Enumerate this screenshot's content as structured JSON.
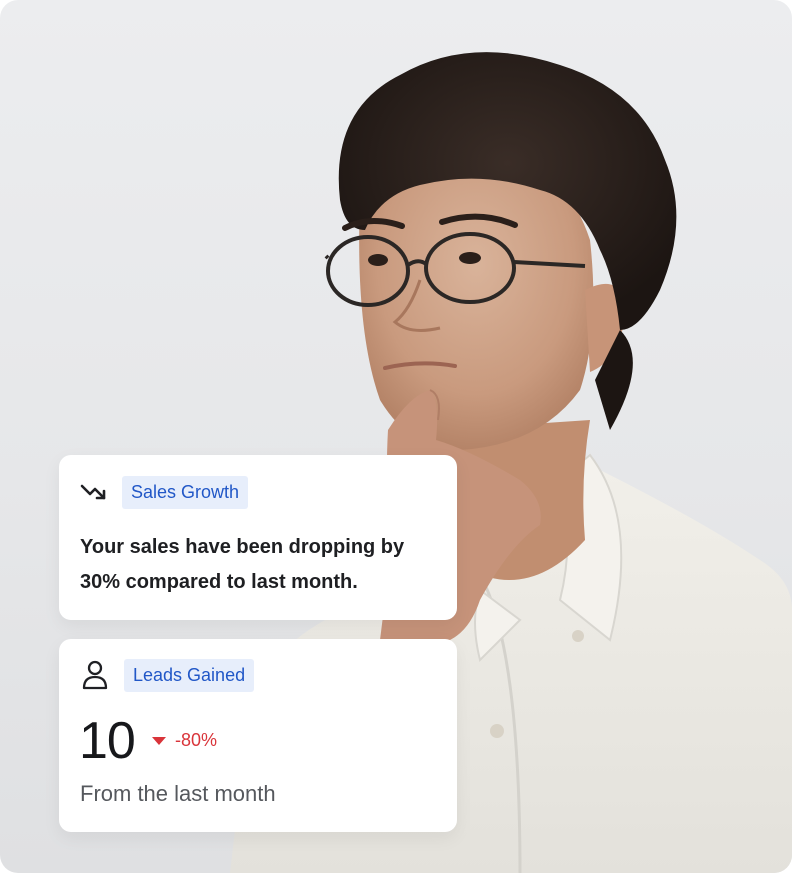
{
  "colors": {
    "tag_bg": "#e7eefb",
    "tag_text": "#2157c7",
    "negative": "#d9343a",
    "card_bg": "#ffffff"
  },
  "photo": {
    "subject": "man with glasses in white polo shirt, hand on chin, looking up"
  },
  "sales_card": {
    "icon": "trending-down-icon",
    "tag": "Sales Growth",
    "message": "Your sales have been dropping by 30% compared to last month."
  },
  "leads_card": {
    "icon": "user-icon",
    "tag": "Leads Gained",
    "value": "10",
    "delta_icon": "down-triangle-icon",
    "delta": "-80%",
    "subtitle": "From the last month"
  }
}
